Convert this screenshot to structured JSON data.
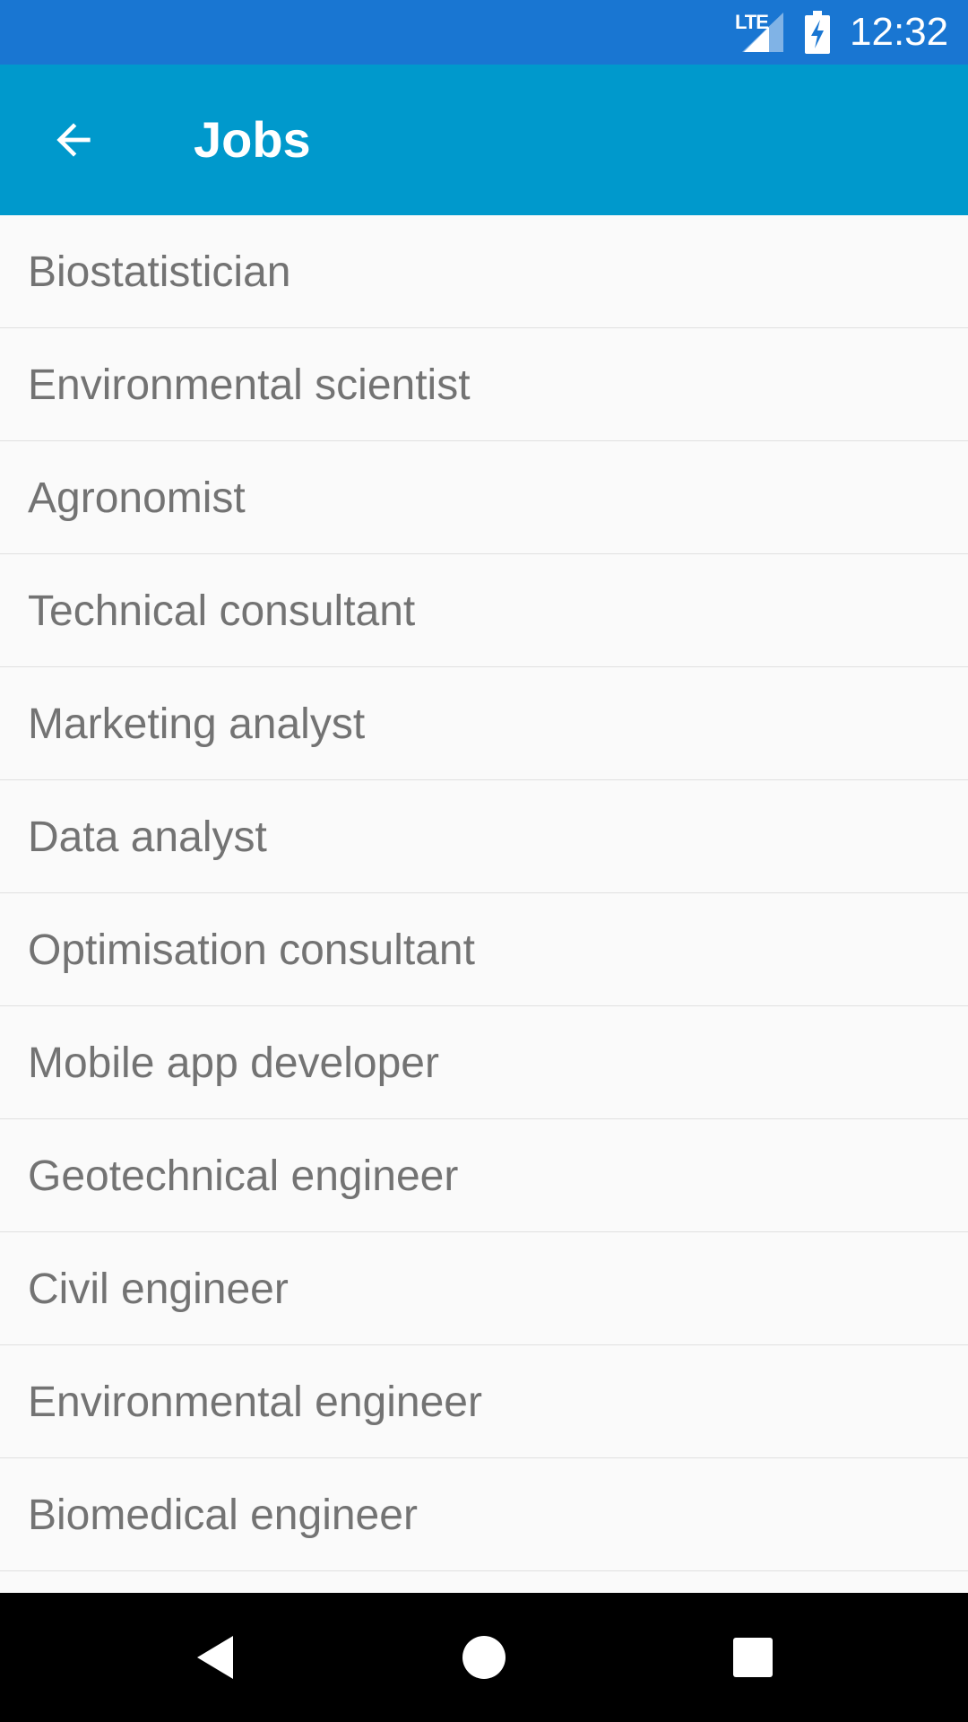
{
  "status_bar": {
    "network_label": "LTE",
    "time": "12:32",
    "background": "#1976d2",
    "icons": [
      "lte-signal-icon",
      "battery-charging-icon"
    ]
  },
  "app_bar": {
    "title": "Jobs",
    "background": "#0099cc",
    "back_icon": "arrow-back-icon"
  },
  "jobs": [
    "Biostatistician",
    "Environmental scientist",
    "Agronomist",
    "Technical consultant",
    "Marketing analyst",
    "Data analyst",
    "Optimisation consultant",
    "Mobile app developer",
    "Geotechnical engineer",
    "Civil engineer",
    "Environmental engineer",
    "Biomedical engineer"
  ],
  "nav_bar": {
    "background": "#000000",
    "icons": [
      "nav-back-icon",
      "nav-home-icon",
      "nav-recents-icon"
    ]
  },
  "colors": {
    "list_background": "#fafafa",
    "list_text": "#737373",
    "divider": "#e0e0e0"
  }
}
